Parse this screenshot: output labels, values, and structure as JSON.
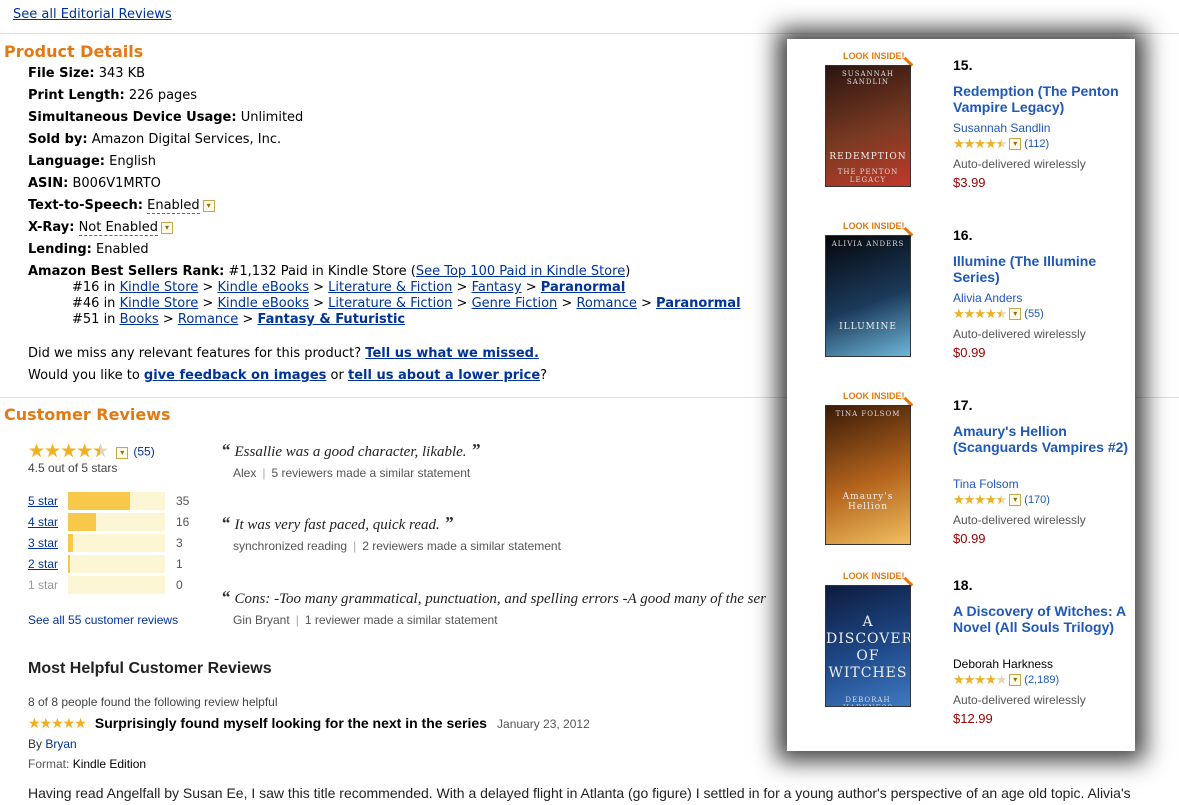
{
  "top_link": "See all Editorial Reviews",
  "product_details": {
    "title": "Product Details",
    "rows": [
      {
        "label": "File Size:",
        "value": "343 KB"
      },
      {
        "label": "Print Length:",
        "value": "226 pages"
      },
      {
        "label": "Simultaneous Device Usage:",
        "value": "Unlimited"
      },
      {
        "label": "Sold by:",
        "value": "Amazon Digital Services, Inc."
      },
      {
        "label": "Language:",
        "value": "English"
      },
      {
        "label": "ASIN:",
        "value": "B006V1MRTO"
      }
    ],
    "text_to_speech": {
      "label": "Text-to-Speech:",
      "value": "Enabled"
    },
    "xray": {
      "label": "X-Ray:",
      "value": "Not Enabled"
    },
    "lending": {
      "label": "Lending:",
      "value": "Enabled"
    },
    "best_sellers": {
      "label": "Amazon Best Sellers Rank:",
      "value": "#1,132 Paid in Kindle Store (",
      "link": "See Top 100 Paid in Kindle Store",
      "close": ")"
    },
    "ranks": [
      {
        "num": "#16 in",
        "path": [
          "Kindle Store",
          "Kindle eBooks",
          "Literature & Fiction",
          "Fantasy"
        ],
        "leaf": "Paranormal"
      },
      {
        "num": "#46 in",
        "path": [
          "Kindle Store",
          "Kindle eBooks",
          "Literature & Fiction",
          "Genre Fiction",
          "Romance"
        ],
        "leaf": "Paranormal"
      },
      {
        "num": "#51 in",
        "path": [
          "Books",
          "Romance"
        ],
        "leaf": "Fantasy & Futuristic"
      }
    ],
    "missed_q": "Did we miss any relevant features for this product?",
    "missed_link": "Tell us what we missed.",
    "feedback_q": "Would you like to",
    "feedback_link": "give feedback on images",
    "or": "or",
    "lower_price_link": "tell us about a lower price",
    "qmark": "?"
  },
  "customer_reviews": {
    "title": "Customer Reviews",
    "rating": 4.5,
    "count_label": "(55)",
    "rating_text": "4.5 out of 5 stars",
    "histogram": [
      {
        "label": "5 star",
        "count": "35",
        "fraction": 0.64
      },
      {
        "label": "4 star",
        "count": "16",
        "fraction": 0.29
      },
      {
        "label": "3 star",
        "count": "3",
        "fraction": 0.055
      },
      {
        "label": "2 star",
        "count": "1",
        "fraction": 0.018
      },
      {
        "label": "1 star",
        "count": "0",
        "fraction": 0
      }
    ],
    "see_all": "See all 55 customer reviews",
    "quotes": [
      {
        "text": "Essallie was a good character, likable.",
        "author": "Alex",
        "similar": "5 reviewers made a similar statement"
      },
      {
        "text": "It was very fast paced, quick read.",
        "author": "synchronized reading",
        "similar": "2 reviewers made a similar statement"
      },
      {
        "text": "Cons: -Too many grammatical, punctuation, and spelling errors -A good many of the ser",
        "author": "Gin Bryant",
        "similar": "1 reviewer made a similar statement"
      }
    ],
    "open_quote": "“",
    "close_quote": "”"
  },
  "most_helpful": {
    "title": "Most Helpful Customer Reviews",
    "helpful": "8 of 8 people found the following review helpful",
    "rating": 5,
    "review_title": "Surprisingly found myself looking for the next in the series",
    "date": "January 23, 2012",
    "by": "By",
    "reviewer": "Bryan",
    "format_label": "Format:",
    "format_value": "Kindle Edition",
    "body": "Having read Angelfall by Susan Ee, I saw this title recommended. With a delayed flight in Atlanta (go figure) I settled in for a young author's perspective of an age old topic. Alivia's"
  },
  "side_list": {
    "look_inside": "LOOK INSIDE!",
    "delivery": "Auto-delivered wirelessly",
    "items": [
      {
        "rank": "15.",
        "title": "Redemption (The Penton Vampire Legacy)",
        "author": "Susannah Sandlin",
        "author_linked": true,
        "rating": 4.5,
        "reviews": "(112)",
        "price": "$3.99",
        "cover_author": "SUSANNAH SANDLIN",
        "cover_title": "REDEMPTION",
        "cover_sub": "THE PENTON LEGACY",
        "colors": [
          "#2a1410",
          "#7a3a22",
          "#c0392b"
        ]
      },
      {
        "rank": "16.",
        "title": "Illumine (The Illumine Series)",
        "author": "Alivia Anders",
        "author_linked": true,
        "rating": 4.5,
        "reviews": "(55)",
        "price": "$0.99",
        "cover_author": "ALIVIA ANDERS",
        "cover_title": "ILLUMINE",
        "cover_sub": "",
        "colors": [
          "#05070c",
          "#1b3a5a",
          "#6fb6d9"
        ]
      },
      {
        "rank": "17.",
        "title": "Amaury's Hellion (Scanguards Vampires #2)",
        "author": "Tina Folsom",
        "author_linked": true,
        "rating": 4.5,
        "reviews": "(170)",
        "price": "$0.99",
        "cover_author": "TINA FOLSOM",
        "cover_title": "Amaury's Hellion",
        "cover_sub": "",
        "colors": [
          "#3a1a08",
          "#b5651d",
          "#f0c060"
        ]
      },
      {
        "rank": "18.",
        "title": "A Discovery of Witches: A Novel (All Souls Trilogy)",
        "author": "Deborah Harkness",
        "author_linked": false,
        "rating": 4,
        "reviews": "(2,189)",
        "price": "$12.99",
        "cover_author": "DEBORAH HARKNESS",
        "cover_title": "A DISCOVERY OF WITCHES",
        "cover_sub": "",
        "colors": [
          "#0d1b3d",
          "#1f4a8a",
          "#3f79c2"
        ]
      }
    ]
  },
  "colors": {
    "link": "#003399",
    "section_title": "#e47911",
    "price": "#990000",
    "star": "#f2b01e",
    "bar_fill": "#f8c84a",
    "bar_bg": "#fdf6d5"
  }
}
